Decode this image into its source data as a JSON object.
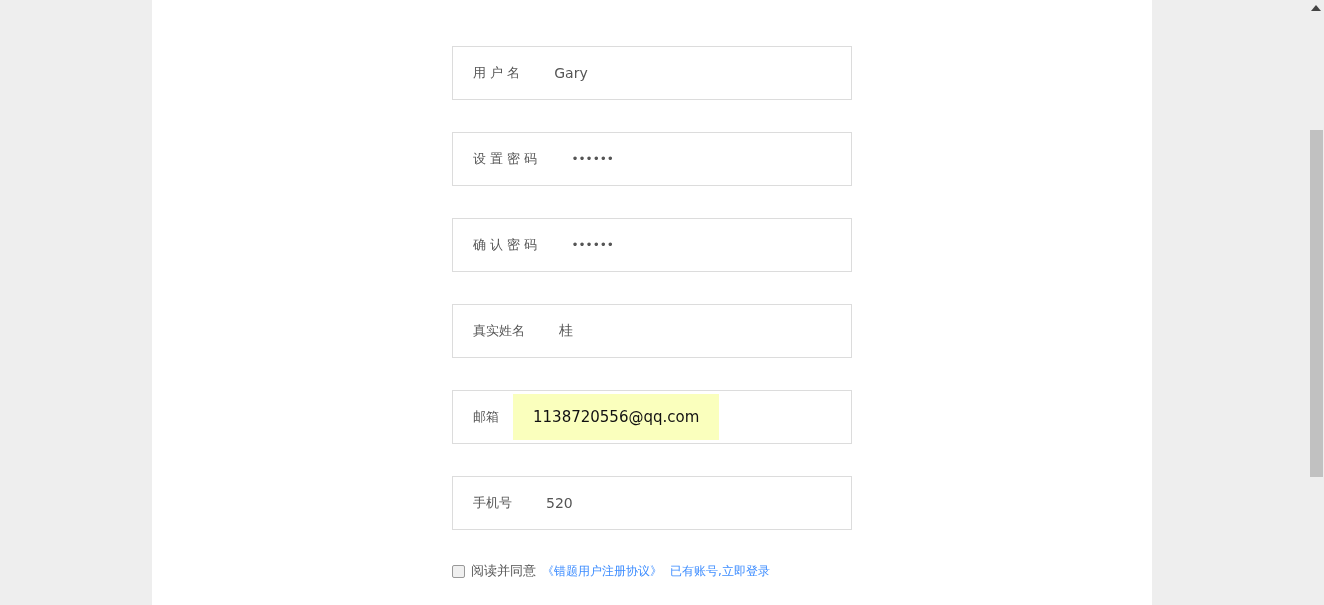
{
  "fields": [
    {
      "label": "用 户 名",
      "value": "Gary",
      "kind": "text",
      "autofilled": false
    },
    {
      "label": "设 置 密 码",
      "value": "••••••",
      "kind": "password",
      "autofilled": false
    },
    {
      "label": "确 认 密 码",
      "value": "••••••",
      "kind": "password",
      "autofilled": false
    },
    {
      "label": "真实姓名",
      "value": "桂",
      "kind": "text",
      "autofilled": false
    },
    {
      "label": "邮箱",
      "value": "1138720556@qq.com",
      "kind": "text",
      "autofilled": true
    },
    {
      "label": "手机号",
      "value": "520",
      "kind": "text",
      "autofilled": false
    }
  ],
  "agreement": {
    "checked": false,
    "text": "阅读并同意",
    "link": "《错题用户注册协议》",
    "login_link": "已有账号,立即登录"
  }
}
